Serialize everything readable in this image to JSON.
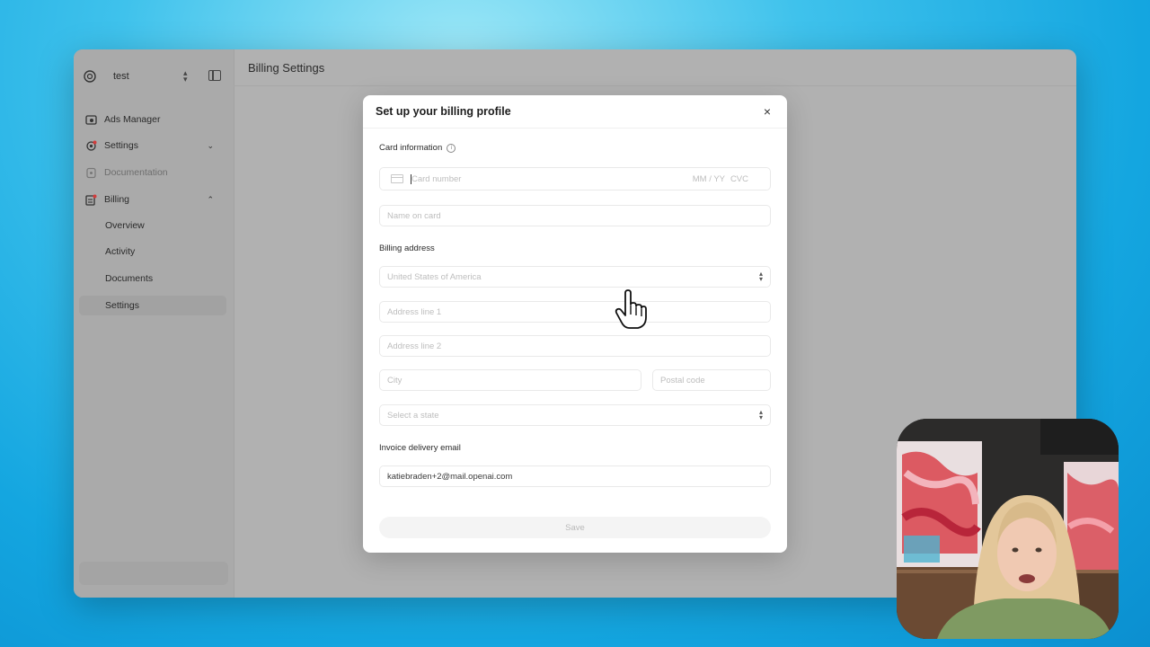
{
  "workspace": {
    "name": "test"
  },
  "sidebar": {
    "items": [
      {
        "label": "Ads Manager",
        "icon": "ads-icon"
      },
      {
        "label": "Settings",
        "icon": "gear-icon",
        "expanded": false
      },
      {
        "label": "Documentation",
        "icon": "doc-icon",
        "muted": true
      },
      {
        "label": "Billing",
        "icon": "billing-icon",
        "expanded": true
      }
    ],
    "billing_subitems": [
      {
        "label": "Overview"
      },
      {
        "label": "Activity"
      },
      {
        "label": "Documents"
      },
      {
        "label": "Settings",
        "active": true
      }
    ]
  },
  "header": {
    "title": "Billing Settings"
  },
  "modal": {
    "title": "Set up your billing profile",
    "card_section_label": "Card information",
    "card_number_placeholder": "Card number",
    "expiry_placeholder": "MM / YY",
    "cvc_placeholder": "CVC",
    "name_placeholder": "Name on card",
    "address_section_label": "Billing address",
    "country_value": "United States of America",
    "address1_placeholder": "Address line 1",
    "address2_placeholder": "Address line 2",
    "city_placeholder": "City",
    "postal_placeholder": "Postal code",
    "state_placeholder": "Select a state",
    "email_section_label": "Invoice delivery email",
    "email_value": "katiebraden+2@mail.openai.com",
    "save_label": "Save"
  },
  "colors": {
    "backdrop": "#14a6e0",
    "overlay": "#b1b1b1",
    "modal_bg": "#ffffff"
  }
}
